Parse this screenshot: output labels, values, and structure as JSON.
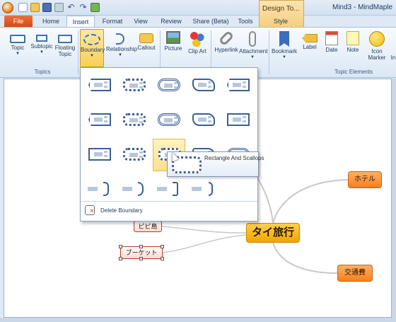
{
  "window": {
    "title": "Mind3 - MindMaple",
    "context_tab_header": "Design To..."
  },
  "qat": {
    "icons": [
      "new-icon",
      "open-icon",
      "save-icon",
      "print-icon",
      "undo-icon",
      "redo-icon",
      "export-icon"
    ]
  },
  "tabs": {
    "file": "File",
    "items": [
      "Home",
      "Insert",
      "Format",
      "View",
      "Review",
      "Share (Beta)",
      "Tools",
      "Style"
    ],
    "active": "Insert"
  },
  "ribbon": {
    "groups": {
      "topics": "Topics",
      "topic_elements": "Topic Elements"
    },
    "topic": "Topic",
    "subtopic": "Subtopic",
    "floating_topic": "Floating Topic",
    "boundary": "Boundary",
    "relationship": "Relationship",
    "callout": "Callout",
    "picture": "Picture",
    "clip_art": "Clip Art",
    "hyperlink": "Hyperlink",
    "attachment": "Attachment",
    "bookmark": "Bookmark",
    "label": "Label",
    "date": "Date",
    "note": "Note",
    "icon_marker": "Icon Marker",
    "truncated": "In"
  },
  "gallery": {
    "rows": [
      [
        "rect",
        "scallop",
        "cloud",
        "wave",
        "poly"
      ],
      [
        "poly",
        "scallop",
        "cloud",
        "wave",
        "rect"
      ],
      [
        "rect",
        "scallop",
        "scallop",
        "wave",
        "cloud"
      ],
      [
        "brace",
        "brace",
        "brace",
        "brace"
      ]
    ],
    "hover_item": "Rectangle And Scallops",
    "delete_label": "Delete Boundary"
  },
  "map": {
    "central": "タイ旅行",
    "hotel": "ホテル",
    "traffic": "交通費",
    "pipi": "ピピ島",
    "phuket": "プーケット"
  },
  "colors": {
    "accent_orange": "#f57f1d",
    "central_gold": "#f0a600",
    "file_tab": "#cf4a14",
    "ribbon_blue": "#dbe7f4"
  }
}
